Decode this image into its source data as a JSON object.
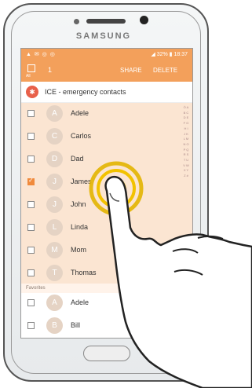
{
  "device": {
    "brand": "SAMSUNG"
  },
  "statusbar": {
    "left_icons": "▲ ✉ ◎ ◎",
    "right": "◢ 32% ▮ 18:37"
  },
  "actionbar": {
    "select_all_label": "All",
    "count": "1",
    "share": "SHARE",
    "delete": "DELETE"
  },
  "ice": {
    "icon": "✱",
    "label": "ICE - emergency contacts"
  },
  "contacts": [
    {
      "initial": "A",
      "name": "Adele",
      "checked": false
    },
    {
      "initial": "C",
      "name": "Carlos",
      "checked": false
    },
    {
      "initial": "D",
      "name": "Dad",
      "checked": false
    },
    {
      "initial": "J",
      "name": "James",
      "checked": true
    },
    {
      "initial": "J",
      "name": "John",
      "checked": false
    },
    {
      "initial": "L",
      "name": "Linda",
      "checked": false
    },
    {
      "initial": "M",
      "name": "Mom",
      "checked": false
    },
    {
      "initial": "T",
      "name": "Thomas",
      "checked": false
    }
  ],
  "favorites": {
    "header": "Favorites",
    "items": [
      {
        "initial": "A",
        "name": "Adele",
        "checked": false
      },
      {
        "initial": "B",
        "name": "Bill",
        "checked": false
      }
    ]
  },
  "index_letters": "Ò A B C D E F G H I J K L M N O P Q R S T U V W X Y Z #",
  "colors": {
    "accent": "#f3a05b",
    "list_bg": "#fbe5d2",
    "tap_ring": "#f2c200"
  },
  "icons": {
    "ice": "ice-star-icon",
    "tap": "tap-gesture-icon",
    "hand": "pointing-hand-icon"
  }
}
